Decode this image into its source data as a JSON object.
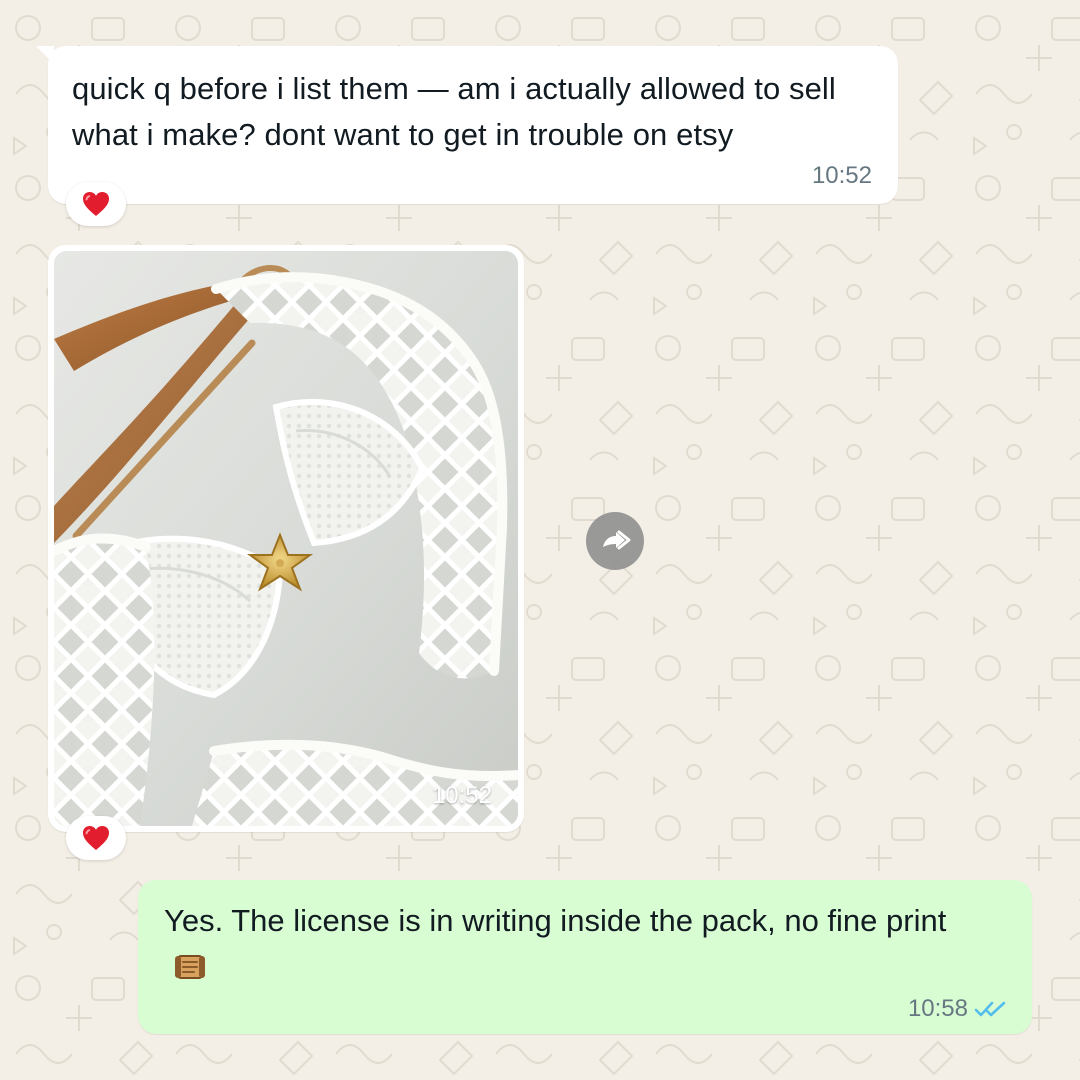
{
  "chat": {
    "messages": [
      {
        "direction": "incoming",
        "text": "quick q before i list them — am i actually allowed to sell what i make? dont want to get in trouble on etsy",
        "time": "10:52",
        "reaction": "heart"
      },
      {
        "direction": "incoming",
        "type": "photo",
        "time": "10:52",
        "reaction": "heart"
      },
      {
        "direction": "outgoing",
        "text": "Yes. The license is in writing inside the pack, no fine print",
        "emoji": "scroll",
        "time": "10:58",
        "status": "read"
      }
    ]
  },
  "icons": {
    "reaction": "heart-icon",
    "forward": "forward-icon",
    "status": "double-check-icon",
    "message_emoji": "scroll-icon"
  },
  "colors": {
    "background": "#f4efe6",
    "incoming_bubble": "#ffffff",
    "outgoing_bubble": "#d9fdd3",
    "timestamp": "#667781",
    "read_ticks": "#53bdeb",
    "heart": "#e11d2e"
  }
}
